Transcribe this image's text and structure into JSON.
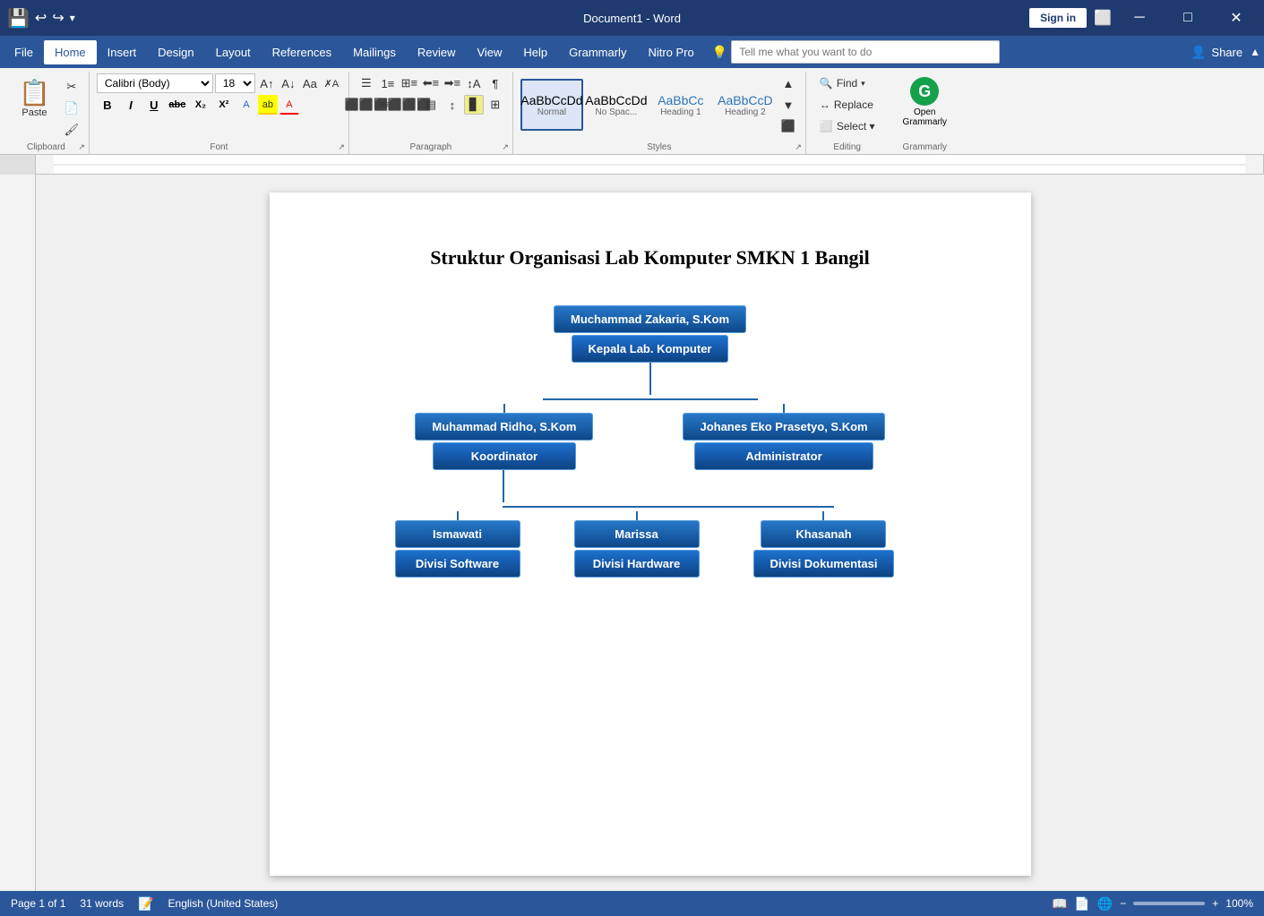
{
  "titlebar": {
    "title": "Document1 - Word",
    "app": "Word",
    "signin": "Sign in",
    "minimize": "─",
    "maximize": "□",
    "close": "✕"
  },
  "menubar": {
    "items": [
      "File",
      "Home",
      "Insert",
      "Design",
      "Layout",
      "References",
      "Mailings",
      "Review",
      "View",
      "Help",
      "Grammarly",
      "Nitro Pro"
    ],
    "active": "Home",
    "tell_me_placeholder": "Tell me what you want to do",
    "share": "Share"
  },
  "ribbon": {
    "clipboard_label": "Clipboard",
    "font_label": "Font",
    "paragraph_label": "Paragraph",
    "styles_label": "Styles",
    "editing_label": "Editing",
    "grammarly_label": "Grammarly",
    "font_name": "Calibri (Body)",
    "font_size": "18",
    "paste_label": "Paste",
    "bold": "B",
    "italic": "I",
    "underline": "U",
    "styles": [
      {
        "label": "Normal",
        "text": "AaBbCcDd",
        "selected": true
      },
      {
        "label": "No Spac...",
        "text": "AaBbCcDd"
      },
      {
        "label": "Heading 1",
        "text": "AaBbCc"
      },
      {
        "label": "Heading 2",
        "text": "AaBbCcD"
      }
    ],
    "find_label": "Find",
    "replace_label": "Replace",
    "select_label": "Select ▾"
  },
  "document": {
    "title": "Struktur Organisasi Lab Komputer SMKN 1 Bangil",
    "orgchart": {
      "root": {
        "name": "Muchammad Zakaria, S.Kom",
        "role": "Kepala Lab. Komputer"
      },
      "level1": [
        {
          "name": "Muhammad Ridho, S.Kom",
          "role": "Koordinator"
        },
        {
          "name": "Johanes Eko Prasetyo, S.Kom",
          "role": "Administrator"
        }
      ],
      "level2": [
        {
          "name": "Ismawati",
          "role": "Divisi Software"
        },
        {
          "name": "Marissa",
          "role": "Divisi Hardware"
        },
        {
          "name": "Khasanah",
          "role": "Divisi Dokumentasi"
        }
      ]
    }
  },
  "statusbar": {
    "page": "Page 1 of 1",
    "words": "31 words",
    "language": "English (United States)",
    "zoom": "100%"
  }
}
